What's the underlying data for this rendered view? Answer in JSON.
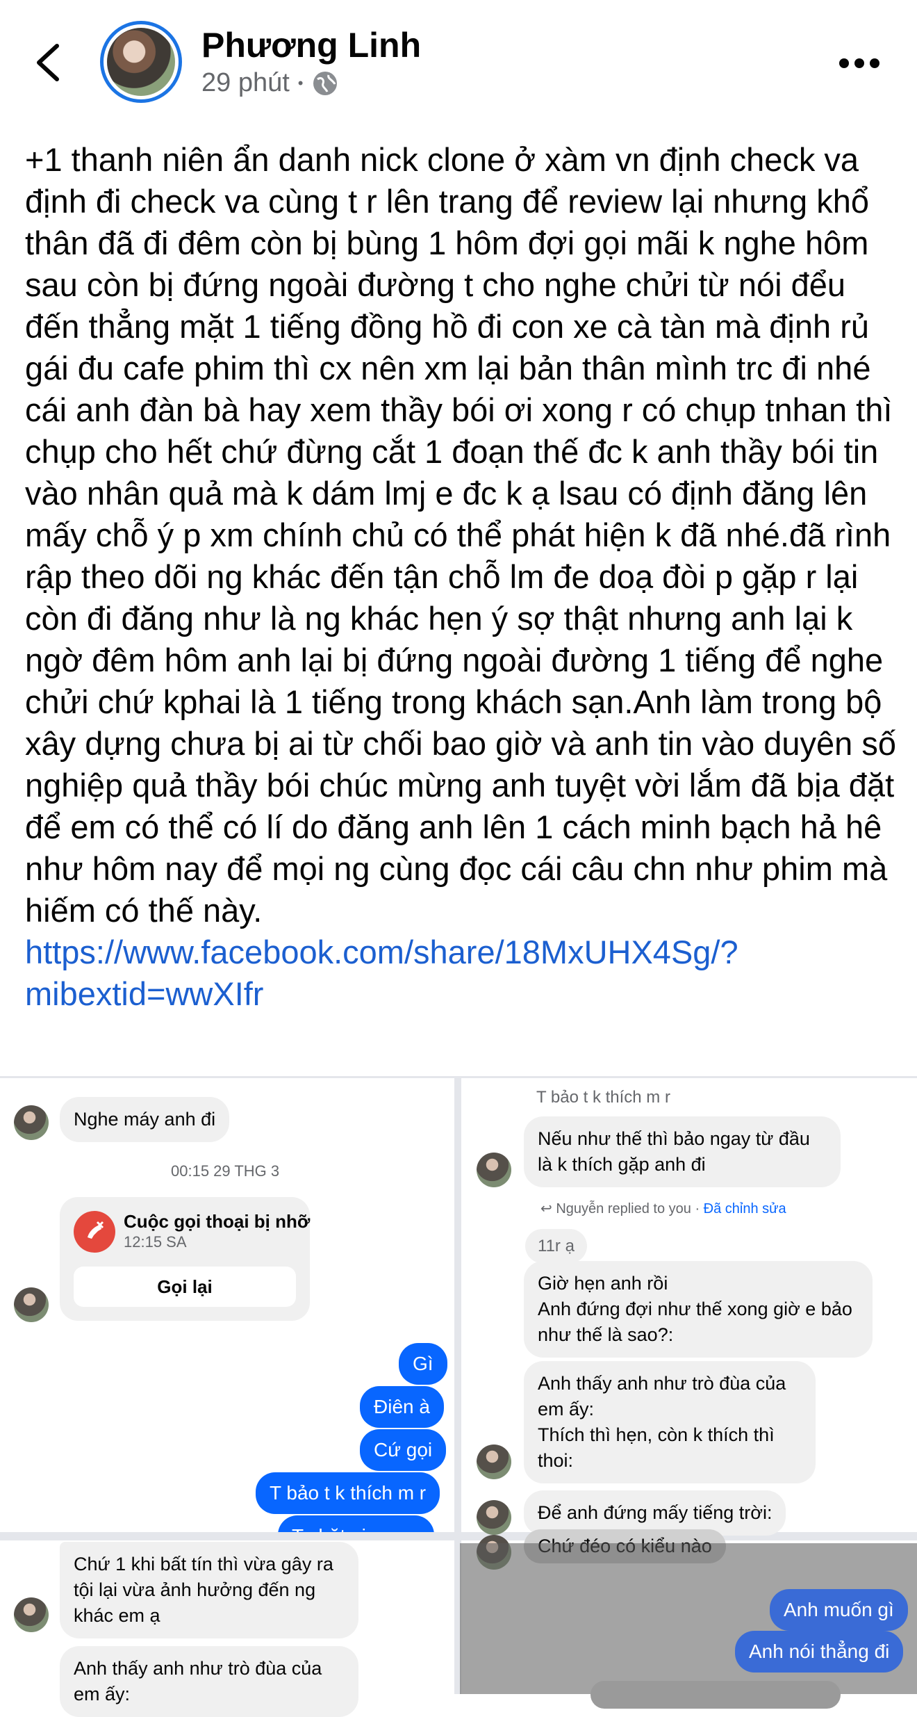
{
  "header": {
    "author_name": "Phương Linh",
    "time_ago": "29 phút",
    "separator": "•",
    "privacy_icon": "globe-icon",
    "back_icon": "chevron-left-icon",
    "more_icon": "more-horizontal-icon"
  },
  "post": {
    "text": "+1 thanh niên ẩn danh nick clone ở xàm vn định check va định đi check va cùng t r lên trang để review lại nhưng khổ thân đã đi đêm còn bị bùng 1 hôm đợi gọi mãi k nghe hôm sau còn bị đứng ngoài đường t cho nghe chửi từ nói đểu đến thẳng mặt 1 tiếng đồng hồ đi con xe cà tàn mà định rủ gái đu cafe phim thì cx nên xm lại bản thân mình trc đi nhé cái anh đàn bà hay xem thầy bói ơi xong r có chụp tnhan thì chụp cho hết chứ đừng cắt 1 đoạn thế đc k anh thầy bói tin vào nhân quả mà k dám lmj e đc k ạ lsau có định đăng lên mấy chỗ ý p xm chính chủ có thể phát hiện k đã nhé.đã rình rập theo dõi ng khác đến tận chỗ lm đe doạ đòi p gặp r lại còn đi đăng như là ng khác hẹn ý sợ thật nhưng anh lại k ngờ đêm hôm anh lại bị đứng ngoài đường 1 tiếng để nghe chửi chứ kphai là 1 tiếng trong khách sạn.Anh làm trong bộ xây dựng chưa bị ai từ chối bao giờ và anh tin vào duyên số nghiệp quả thầy bói chúc mừng anh tuyệt vời lắm đã bịa đặt để em có thể có lí do đăng anh lên 1 cách minh bạch hả hê như hôm nay để mọi ng cùng đọc cái câu chn như phim mà hiếm có thế này. ",
    "link": "https://www.facebook.com/share/18MxUHX4Sg/?mibextid=wwXIfr"
  },
  "chat_left": {
    "msg1": "Nghe máy anh đi",
    "timestamp": "00:15 29 THG 3",
    "call_title": "Cuộc gọi thoại bị nhỡ",
    "call_time": "12:15 SA",
    "call_back": "Gọi lại",
    "call_icon": "missed-call-icon",
    "out1": "Gì",
    "out2": "Điên à",
    "out3": "Cứ gọi",
    "out4": "T bảo t k thích m r",
    "out5": "T chặt giọng m"
  },
  "chat_right": {
    "top": "T bảo t k thích m r",
    "msg1": "Nếu như thế thì bảo ngay từ đầu là k thích gặp anh đi",
    "reply_line": "Nguyễn replied to you · ",
    "edited": "Đã chỉnh sửa",
    "reply_quote": "11r ạ",
    "msg2": "Giờ hẹn anh rồi\nAnh đứng đợi như thế xong giờ e bảo như thế là sao?:",
    "msg3": "Anh thấy anh như trò đùa của em ấy:\nThích thì hẹn, còn k thích thì thoi:",
    "msg4": "Để anh đứng mấy tiếng trời:"
  },
  "chat_bottom_left": {
    "msg1": "Chứ 1 khi bất tín thì vừa gây ra tội lại vừa ảnh hưởng đến ng khác em ạ",
    "msg2": "Anh thấy anh như trò đùa của em ấy:"
  },
  "chat_bottom_right": {
    "msg1": "Chứ đéo có kiểu nào",
    "out1": "Anh muốn gì",
    "out2": "Anh nói thẳng đi"
  }
}
